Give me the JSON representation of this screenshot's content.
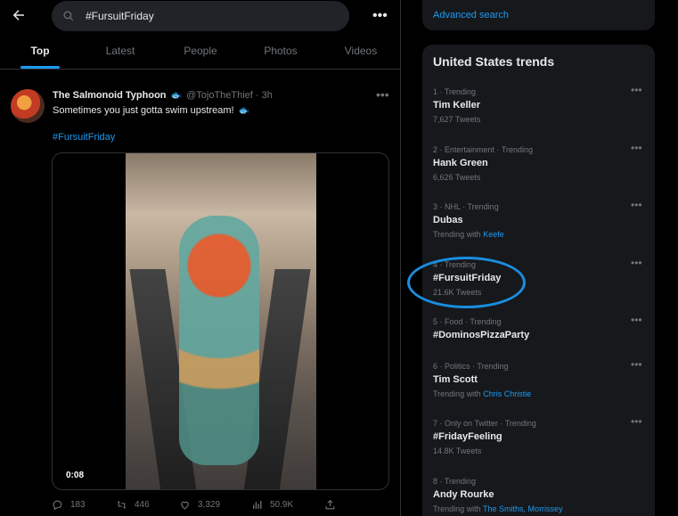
{
  "header": {
    "back_icon": "back-arrow-icon",
    "search_value": "#FursuitFriday",
    "more_icon": "more-icon"
  },
  "tabs": [
    {
      "label": "Top",
      "active": true
    },
    {
      "label": "Latest",
      "active": false
    },
    {
      "label": "People",
      "active": false
    },
    {
      "label": "Photos",
      "active": false
    },
    {
      "label": "Videos",
      "active": false
    }
  ],
  "tweet": {
    "name": "The Salmonoid Typhoon",
    "handle": "@TojoTheThief",
    "time": "3h",
    "separator": "·",
    "text": "Sometimes you just gotta swim upstream!",
    "hashtag": "#FursuitFriday",
    "video_time": "0:08",
    "stats": {
      "replies": "183",
      "retweets": "446",
      "likes": "3,329",
      "views": "50.9K"
    }
  },
  "sidebar": {
    "advanced_search": "Advanced search",
    "trends_title": "United States trends",
    "trends": [
      {
        "meta": "1 · Trending",
        "name": "Tim Keller",
        "sub": "7,627 Tweets"
      },
      {
        "meta": "2 · Entertainment · Trending",
        "name": "Hank Green",
        "sub": "6,626 Tweets"
      },
      {
        "meta": "3 · NHL · Trending",
        "name": "Dubas",
        "sub_prefix": "Trending with",
        "sub_link": "Keefe"
      },
      {
        "meta": "4 · Trending",
        "name": "#FursuitFriday",
        "sub": "21.6K Tweets"
      },
      {
        "meta": "5 · Food · Trending",
        "name": "#DominosPizzaParty"
      },
      {
        "meta": "6 · Politics · Trending",
        "name": "Tim Scott",
        "sub_prefix": "Trending with",
        "sub_link": "Chris Christie"
      },
      {
        "meta": "7 · Only on Twitter · Trending",
        "name": "#FridayFeeling",
        "sub": "14.8K Tweets"
      },
      {
        "meta": "8 · Trending",
        "name": "Andy Rourke",
        "sub_prefix": "Trending with",
        "sub_link": "The Smiths, Morrissey"
      }
    ]
  },
  "colors": {
    "accent": "#1d9bf0",
    "background": "#000000",
    "panel": "#16181c",
    "muted": "#71767b",
    "highlight_circle": "#1a8ee0"
  }
}
